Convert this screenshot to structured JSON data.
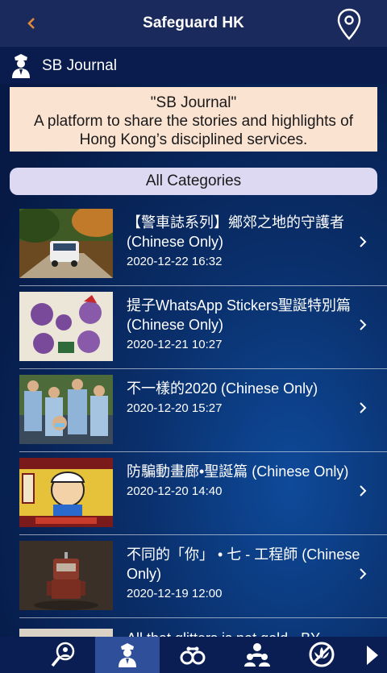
{
  "header": {
    "title": "Safeguard HK",
    "back_icon": "chevron-left-icon",
    "location_icon": "map-pin-icon"
  },
  "section": {
    "title": "SB Journal",
    "icon": "police-officer-icon"
  },
  "banner": {
    "line1": "\"SB Journal\"",
    "line2": "A platform to share the stories and highlights of",
    "line3": "Hong Kong’s disciplined services."
  },
  "category": {
    "label": "All Categories"
  },
  "articles": [
    {
      "title": "【警車誌系列】鄉郊之地的守護者 (Chinese Only)",
      "date": "2020-12-22 16:32"
    },
    {
      "title": "提子WhatsApp Stickers聖誕特別篇 (Chinese Only)",
      "date": "2020-12-21 10:27"
    },
    {
      "title": "不一樣的2020 (Chinese Only)",
      "date": "2020-12-20 15:27"
    },
    {
      "title": "防騙動畫廊•聖誕篇 (Chinese Only)",
      "date": "2020-12-20 14:40"
    },
    {
      "title": "不同的「你」 • 七 - 工程師 (Chinese Only)",
      "date": "2020-12-19 12:00"
    }
  ],
  "partial_article": {
    "title": "All that glitters is not gold - BY"
  },
  "tabs": [
    {
      "icon": "magnifier-icon"
    },
    {
      "icon": "police-officer-icon",
      "active": true
    },
    {
      "icon": "handcuffs-icon"
    },
    {
      "icon": "people-icon"
    },
    {
      "icon": "no-drugs-icon"
    },
    {
      "icon": "play-arrow-icon"
    }
  ],
  "colors": {
    "topbar": "#1b2a5c",
    "accent": "#e08a3a",
    "banner": "#fbe3d2",
    "category": "#ddd9f2",
    "active_tab": "#2f4f9b"
  }
}
